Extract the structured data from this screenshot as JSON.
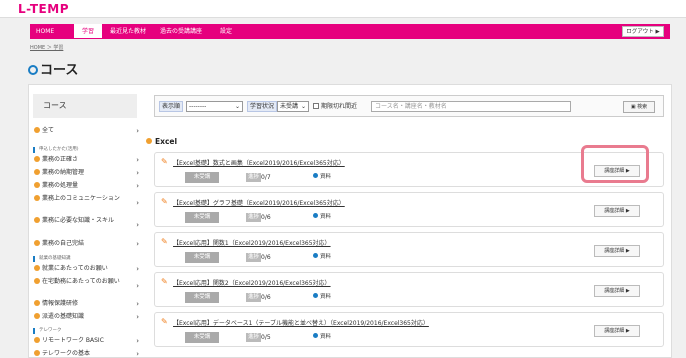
{
  "logo": "L-TEMP",
  "nav": {
    "items": [
      {
        "label": "HOME"
      },
      {
        "label": "学習"
      },
      {
        "label": "最近見た教材"
      },
      {
        "label": "過去の受講講座"
      },
      {
        "label": "設定"
      }
    ],
    "logout": "ログアウト ▶"
  },
  "breadcrumb": "HOME ＞ 学習",
  "page_title": "コース",
  "sidebar": {
    "header": "コース",
    "all": "全て",
    "sections": [
      {
        "label": "申込したかた(活用)",
        "items": [
          "業務の正確さ",
          "業務の納期管理",
          "業務の処理量",
          "業務上のコミュニケーション",
          "業務に必要な知識・スキル",
          "業務の自己完結"
        ]
      },
      {
        "label": "就業の基礎知識",
        "items": [
          "就業にあたってのお願い",
          "在宅勤務にあたってのお願い",
          "情報保護研修",
          "派遣の基礎知識"
        ]
      },
      {
        "label": "テレワーク",
        "items": [
          "リモートワーク BASIC",
          "テレワークの基本"
        ]
      }
    ]
  },
  "filter": {
    "sort_label": "表示順",
    "sort_value": "--------",
    "status_label": "学習状況",
    "status_value": "未受講",
    "deadline_label": "期限切れ間近",
    "search_placeholder": "コース名・講座名・教材名",
    "search_button": "検索"
  },
  "category": "Excel",
  "courses": [
    {
      "title": "【Excel基礎】数式と画集（Excel2019/2016/Excel365対応）",
      "status": "未受講",
      "progress_label": "進捗",
      "progress": "0/7",
      "material": "資料",
      "detail": "講座詳細 ▶"
    },
    {
      "title": "【Excel基礎】グラフ基礎（Excel2019/2016/Excel365対応）",
      "status": "未受講",
      "progress_label": "進捗",
      "progress": "0/6",
      "material": "資料",
      "detail": "講座詳細 ▶"
    },
    {
      "title": "【Excel応用】関数1（Excel2019/2016/Excel365対応）",
      "status": "未受講",
      "progress_label": "進捗",
      "progress": "0/6",
      "material": "資料",
      "detail": "講座詳細 ▶"
    },
    {
      "title": "【Excel応用】関数2（Excel2019/2016/Excel365対応）",
      "status": "未受講",
      "progress_label": "進捗",
      "progress": "0/6",
      "material": "資料",
      "detail": "講座詳細 ▶"
    },
    {
      "title": "【Excel応用】データベース1（テーブル機能と並べ替え）（Excel2019/2016/Excel365対応）",
      "status": "未受講",
      "progress_label": "進捗",
      "progress": "0/5",
      "material": "資料",
      "detail": "講座詳細 ▶"
    }
  ],
  "colors": {
    "accent": "#e6007e",
    "highlight": "#e97b8f",
    "link": "#1a7dc4"
  }
}
